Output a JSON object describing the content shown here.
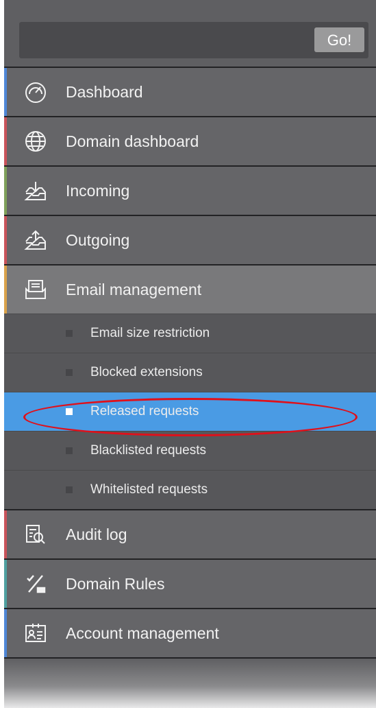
{
  "search": {
    "value": "",
    "go_label": "Go!"
  },
  "menu": {
    "items": [
      {
        "label": "Dashboard",
        "icon": "speedometer-icon",
        "stripe": "#4f86d6"
      },
      {
        "label": "Domain dashboard",
        "icon": "globe-icon",
        "stripe": "#c8535a"
      },
      {
        "label": "Incoming",
        "icon": "inbox-download-icon",
        "stripe": "#7fa05a"
      },
      {
        "label": "Outgoing",
        "icon": "outbox-upload-icon",
        "stripe": "#c8535a"
      },
      {
        "label": "Email management",
        "icon": "email-tray-icon",
        "stripe": "#d9a24a"
      },
      {
        "label": "Audit log",
        "icon": "audit-search-icon",
        "stripe": "#c8535a"
      },
      {
        "label": "Domain Rules",
        "icon": "percent-rules-icon",
        "stripe": "#4fa0a0"
      },
      {
        "label": "Account management",
        "icon": "account-card-icon",
        "stripe": "#4f86d6"
      }
    ],
    "submenu": [
      {
        "label": "Email size restriction"
      },
      {
        "label": "Blocked extensions"
      },
      {
        "label": "Released requests"
      },
      {
        "label": "Blacklisted requests"
      },
      {
        "label": "Whitelisted requests"
      }
    ],
    "active_submenu": "Released requests",
    "active_color": "#4a9be4",
    "annotation_color": "#e0101a"
  }
}
